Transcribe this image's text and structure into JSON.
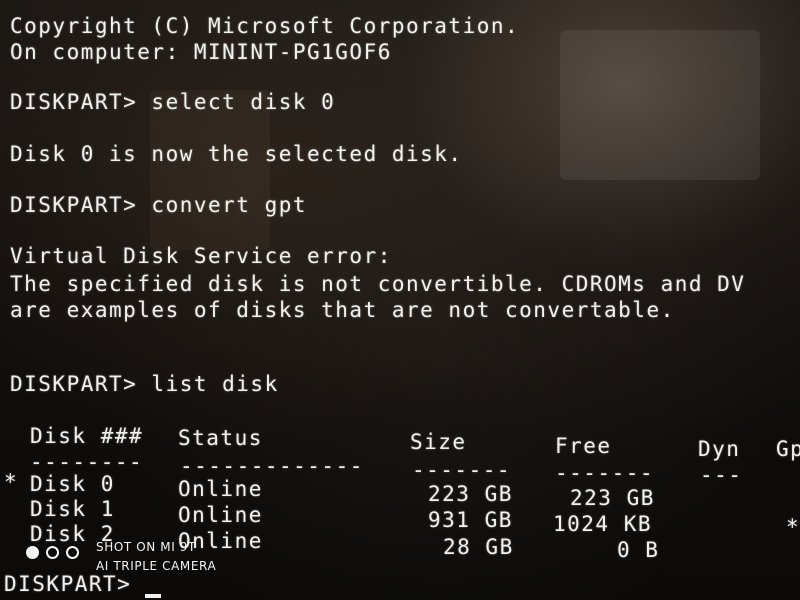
{
  "console": {
    "copyright": "Copyright (C) Microsoft Corporation.",
    "computer": "On computer: MININT-PG1GOF6",
    "cmd_select": "DISKPART> select disk 0",
    "msg_selected": "Disk 0 is now the selected disk.",
    "cmd_convert": "DISKPART> convert gpt",
    "err_title": "Virtual Disk Service error:",
    "err_line1": "The specified disk is not convertible. CDROMs and DV",
    "err_line2": "are examples of disks that are not convertable.",
    "cmd_list": "DISKPART> list disk",
    "prompt": "DISKPART> "
  },
  "disk_table": {
    "headers": [
      "Disk ###",
      "Status",
      "Size",
      "Free",
      "Dyn",
      "Gp"
    ],
    "separators": [
      "--------",
      "-------------",
      "-------",
      "-------",
      "---",
      "---"
    ],
    "rows": [
      {
        "marker": "*",
        "disk": "Disk 0",
        "status": "Online",
        "size": "223 GB",
        "free": "223 GB",
        "dyn": "",
        "gpt": ""
      },
      {
        "marker": "",
        "disk": "Disk 1",
        "status": "Online",
        "size": "931 GB",
        "free": "1024 KB",
        "dyn": "",
        "gpt": "*"
      },
      {
        "marker": "",
        "disk": "Disk 2",
        "status": "Online",
        "size": "28 GB",
        "free": "0 B",
        "dyn": "",
        "gpt": ""
      }
    ]
  },
  "watermark": {
    "line1": "SHOT ON MI 9T",
    "line2": "AI TRIPLE CAMERA"
  },
  "colors": {
    "console_text": "#f1f1ee",
    "background": "#0a0908"
  }
}
